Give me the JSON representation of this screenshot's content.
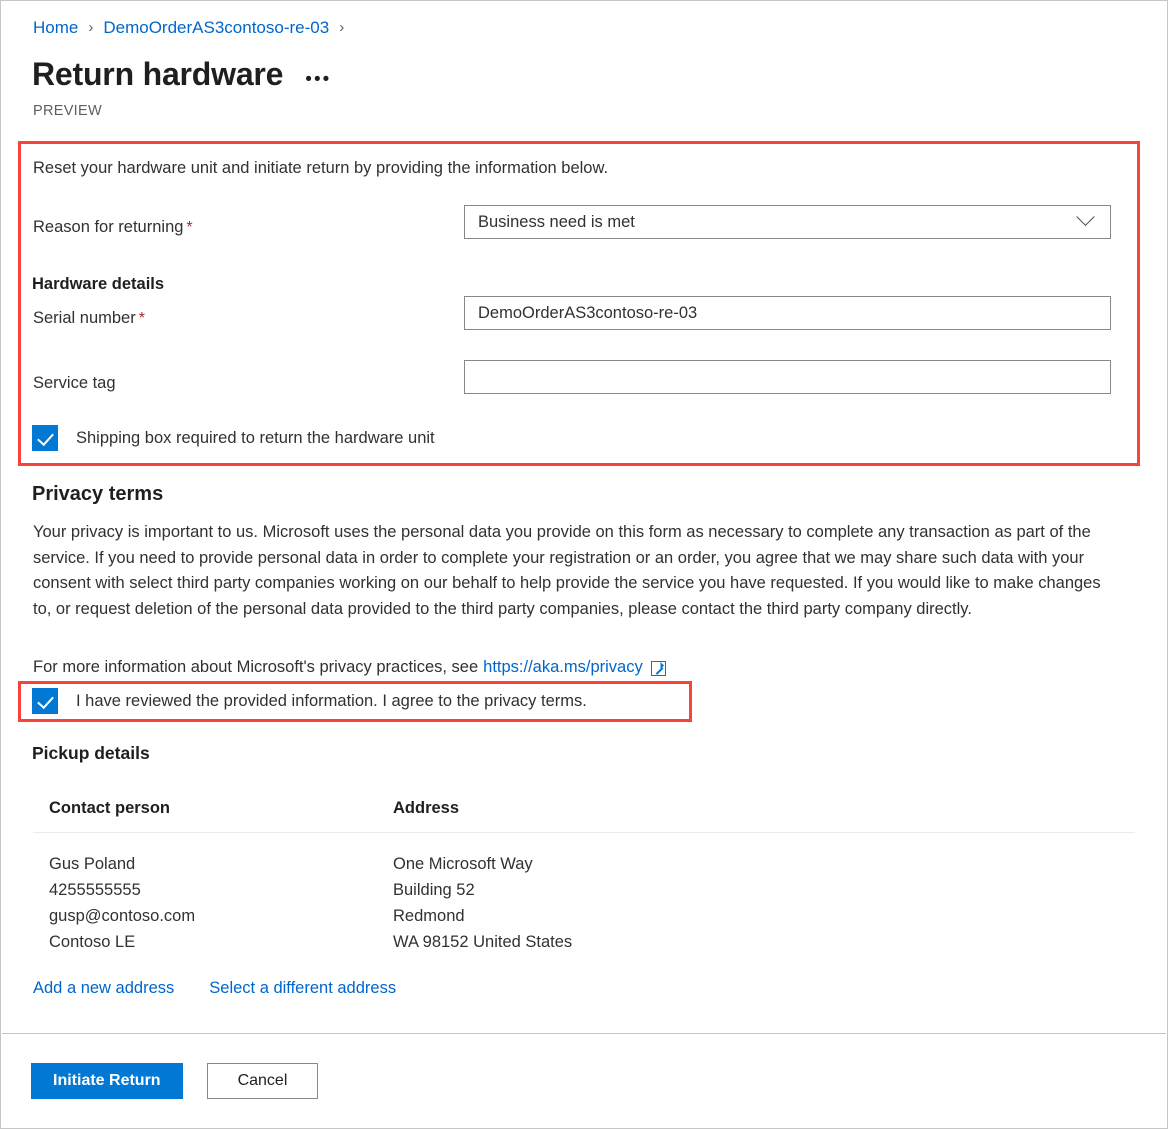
{
  "breadcrumb": {
    "items": [
      {
        "label": "Home"
      },
      {
        "label": "DemoOrderAS3contoso-re-03"
      }
    ],
    "separator": "›"
  },
  "header": {
    "title": "Return hardware",
    "more_label": "•••",
    "preview_tag": "PREVIEW"
  },
  "form": {
    "intro": "Reset your hardware unit and initiate return by providing the information below.",
    "reason_label": "Reason for returning",
    "required_mark": "*",
    "reason_value": "Business need is met",
    "hardware_details_heading": "Hardware details",
    "serial_label": "Serial number",
    "serial_value": "DemoOrderAS3contoso-re-03",
    "serial_placeholder": "",
    "service_tag_label": "Service tag",
    "service_tag_value": "",
    "service_tag_placeholder": "",
    "shipping_box_label": "Shipping box required to return the hardware unit"
  },
  "privacy": {
    "heading": "Privacy terms",
    "paragraph": "Your privacy is important to us. Microsoft uses the personal data you provide on this form as necessary to complete any transaction as part of the service. If you need to provide personal data in order to complete your registration or an order, you agree that we may share such data with your consent with select third party companies working on our behalf to help provide the service you have requested. If you would like to make changes to, or request deletion of the personal data provided to the third party companies, please contact the third party company directly.",
    "link_prefix": "For more information about Microsoft's privacy practices, see",
    "link_text": "https://aka.ms/privacy",
    "agree_label": "I have reviewed the provided information. I agree to the privacy terms."
  },
  "pickup": {
    "heading": "Pickup details",
    "columns": [
      "Contact person",
      "Address"
    ],
    "rows": [
      {
        "contact": [
          "Gus Poland",
          "4255555555",
          "gusp@contoso.com",
          "Contoso LE"
        ],
        "address": [
          "One Microsoft Way",
          "Building 52",
          "Redmond",
          "WA 98152 United States"
        ]
      }
    ],
    "add_address_link": "Add a new address",
    "select_address_link": "Select a different address"
  },
  "footer": {
    "primary_button": "Initiate Return",
    "secondary_button": "Cancel"
  },
  "colors": {
    "accent": "#0078d4",
    "link": "#0066cc",
    "annotation": "#f9423a",
    "required": "#a4262c"
  }
}
